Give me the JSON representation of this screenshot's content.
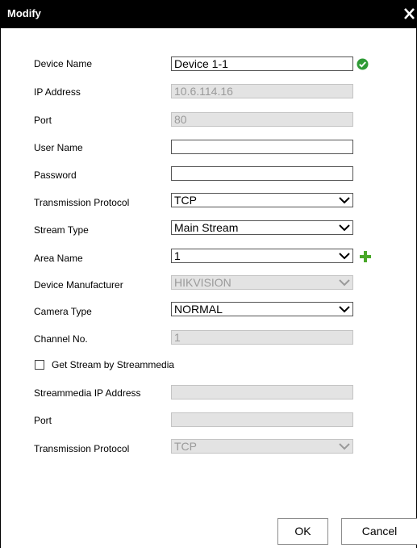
{
  "dialog": {
    "title": "Modify",
    "close_icon": "close-icon"
  },
  "form": {
    "device_name": {
      "label": "Device Name",
      "value": "Device 1-1",
      "status_icon": "check-circle-icon",
      "status_color": "#2e9a35"
    },
    "ip_address": {
      "label": "IP Address",
      "value": "10.6.114.16"
    },
    "port": {
      "label": "Port",
      "value": "80"
    },
    "user_name": {
      "label": "User Name",
      "value": ""
    },
    "password": {
      "label": "Password",
      "value": ""
    },
    "transmission_protocol": {
      "label": "Transmission Protocol",
      "value": "TCP"
    },
    "stream_type": {
      "label": "Stream Type",
      "value": "Main Stream"
    },
    "area_name": {
      "label": "Area Name",
      "value": "1",
      "add_icon": "plus-icon",
      "add_color": "#49a829"
    },
    "device_manufacturer": {
      "label": "Device Manufacturer",
      "value": "HIKVISION"
    },
    "camera_type": {
      "label": "Camera Type",
      "value": "NORMAL"
    },
    "channel_no": {
      "label": "Channel No.",
      "value": "1"
    },
    "get_stream": {
      "label": "Get Stream by Streammedia",
      "checked": false
    },
    "streammedia_ip": {
      "label": "Streammedia IP Address",
      "value": ""
    },
    "streammedia_port": {
      "label": "Port",
      "value": ""
    },
    "streammedia_protocol": {
      "label": "Transmission Protocol",
      "value": "TCP"
    }
  },
  "buttons": {
    "ok": "OK",
    "cancel": "Cancel"
  }
}
